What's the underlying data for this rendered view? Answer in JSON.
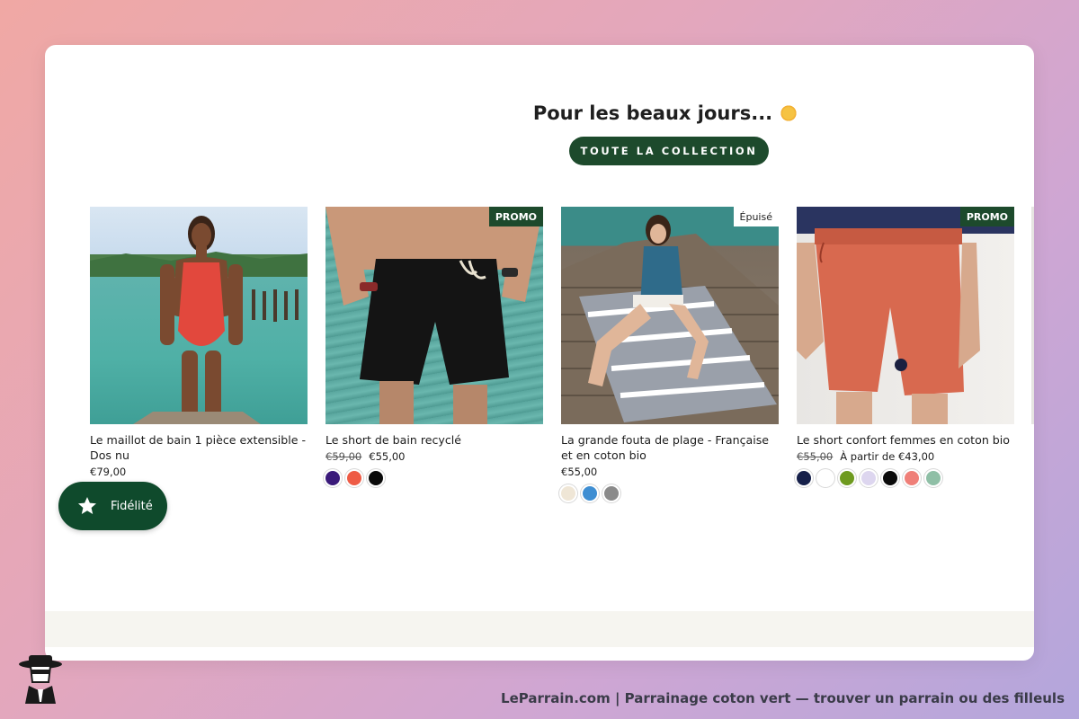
{
  "section": {
    "title": "Pour les beaux jours...",
    "collection_button": "TOUTE LA COLLECTION"
  },
  "products": [
    {
      "title": "Le maillot de bain 1 pièce extensible - Dos nu",
      "price": "€79,00",
      "badge": null,
      "swatches": []
    },
    {
      "title": "Le short de bain recyclé",
      "old_price": "€59,00",
      "price": "€55,00",
      "badge": "PROMO",
      "swatches": [
        "#3a1a7a",
        "#ee5b45",
        "#0a0a0a"
      ]
    },
    {
      "title": "La grande fouta de plage - Française et en coton bio",
      "price": "€55,00",
      "badge": "Épuisé",
      "swatches": [
        "#efe6d6",
        "#3f8ed2",
        "#8a8a8a"
      ]
    },
    {
      "title": "Le short confort femmes en coton bio",
      "old_price": "€55,00",
      "price": "À partir de €43,00",
      "badge": "PROMO",
      "swatches": [
        "#16204a",
        "#ffffff",
        "#6e9a1f",
        "#ddd6ef",
        "#0a0a0a",
        "#ef7f78",
        "#8fbfa6"
      ]
    }
  ],
  "fidelity_button": "Fidélité",
  "footer": "LeParrain.com | Parrainage coton vert — trouver un parrain ou des filleuls",
  "colors": {
    "brand_green": "#1d4a2c",
    "promo_badge": "#1d4a2c"
  }
}
